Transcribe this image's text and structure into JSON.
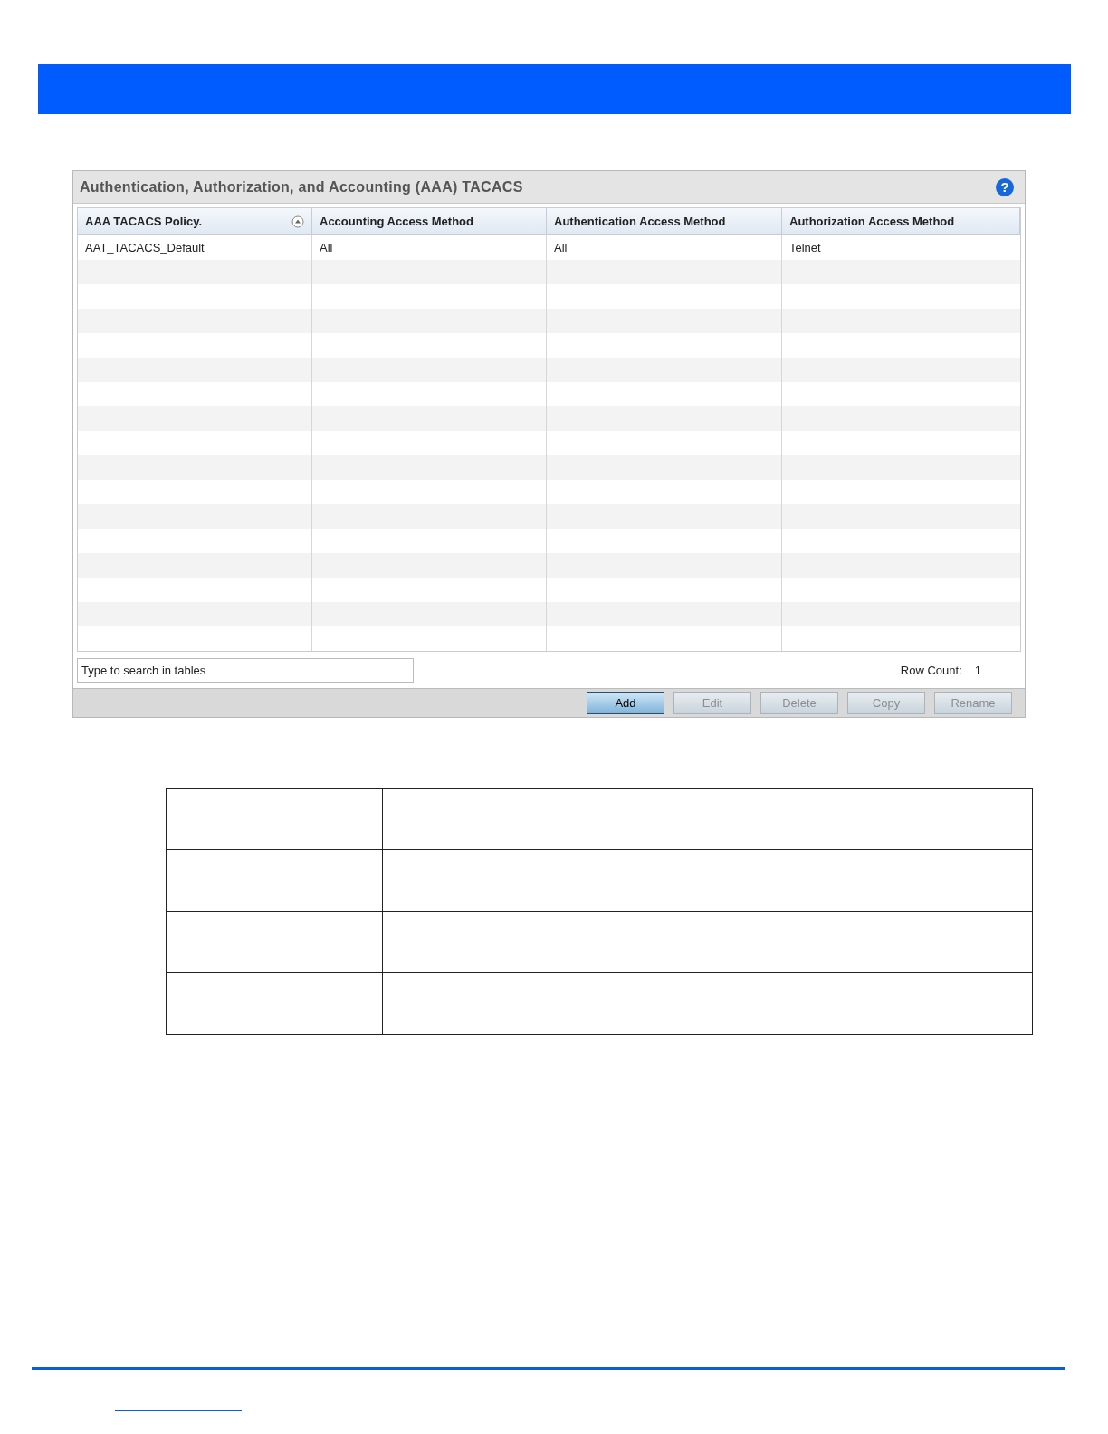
{
  "panel": {
    "title": "Authentication, Authorization, and Accounting (AAA) TACACS",
    "help_icon": "?"
  },
  "table": {
    "columns": [
      {
        "label": "AAA TACACS Policy.",
        "sorted": true
      },
      {
        "label": "Accounting Access Method",
        "sorted": false
      },
      {
        "label": "Authentication Access Method",
        "sorted": false
      },
      {
        "label": "Authorization Access Method",
        "sorted": false
      }
    ],
    "rows": [
      [
        "AAT_TACACS_Default",
        "All",
        "All",
        "Telnet"
      ]
    ]
  },
  "search": {
    "placeholder": "Type to search in tables"
  },
  "row_count": {
    "label": "Row Count:",
    "value": "1"
  },
  "buttons": [
    {
      "label": "Add",
      "disabled": false
    },
    {
      "label": "Edit",
      "disabled": true
    },
    {
      "label": "Delete",
      "disabled": true
    },
    {
      "label": "Copy",
      "disabled": true
    },
    {
      "label": "Rename",
      "disabled": true
    }
  ]
}
